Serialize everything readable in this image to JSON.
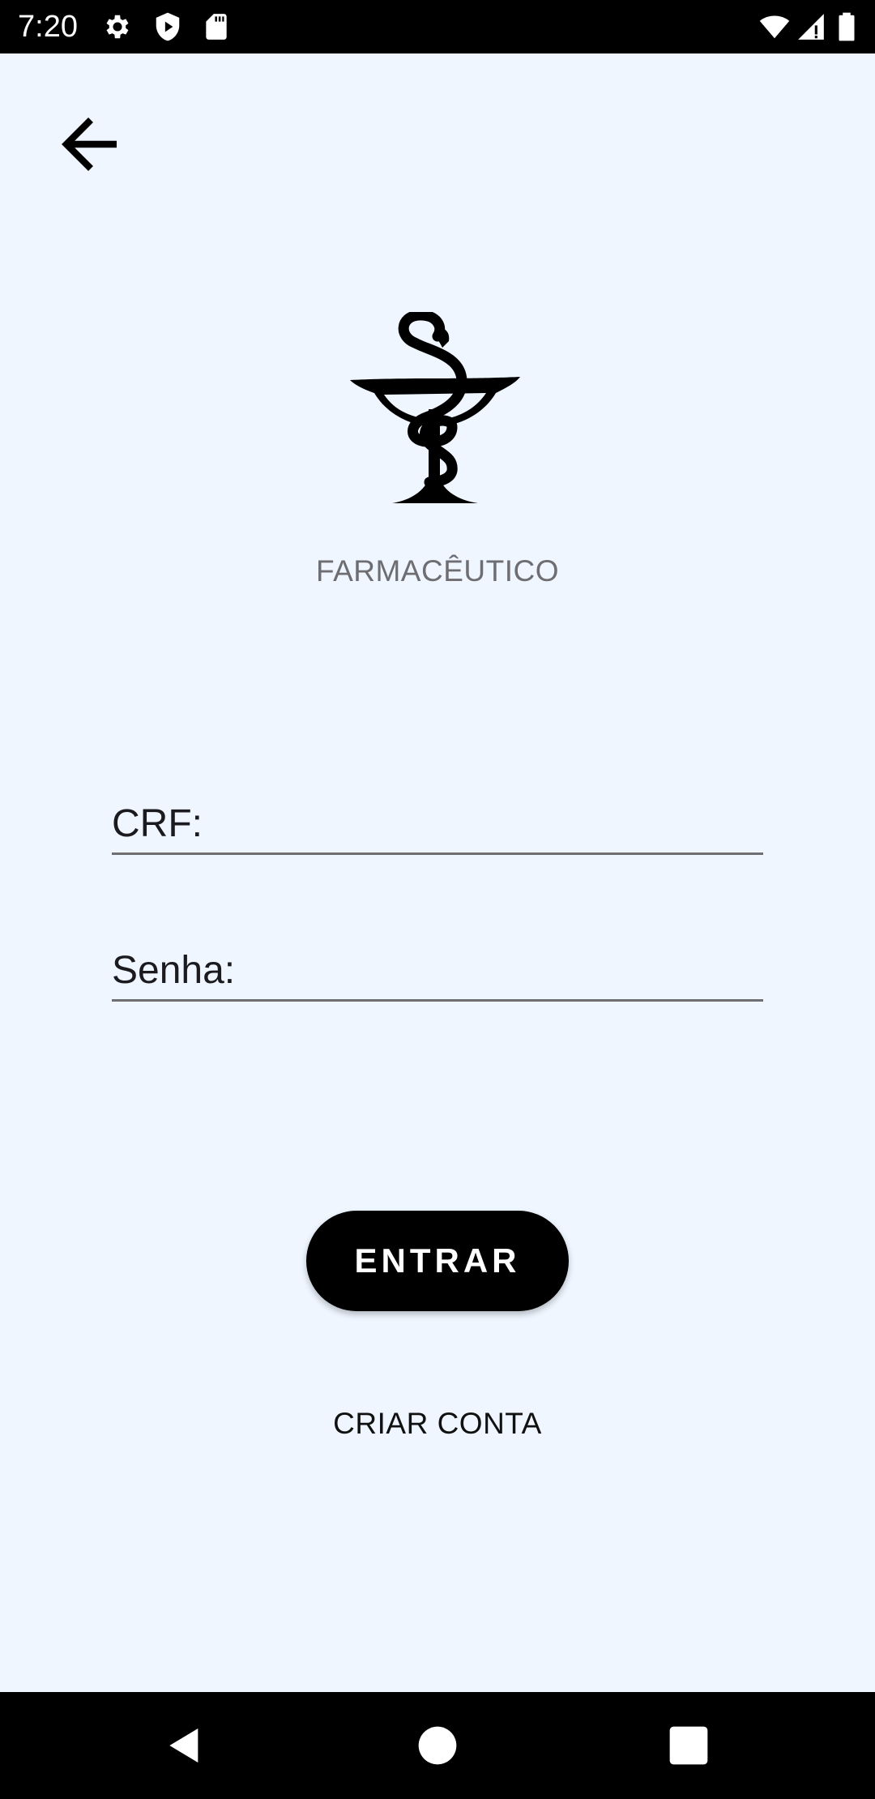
{
  "status_bar": {
    "time": "7:20",
    "left_icons": [
      "gear-icon",
      "shield-play-icon",
      "sd-card-icon"
    ],
    "right_icons": [
      "wifi-icon",
      "signal-icon",
      "battery-icon"
    ]
  },
  "header": {
    "back_icon": "arrow-left-icon"
  },
  "logo": {
    "icon": "bowl-of-hygieia-icon"
  },
  "role_label": "FARMACÊUTICO",
  "form": {
    "crf_label": "CRF:",
    "crf_value": "",
    "senha_label": "Senha:",
    "senha_value": ""
  },
  "actions": {
    "enter_label": "ENTRAR",
    "create_account_label": "CRIAR CONTA"
  },
  "nav_bar": {
    "icons": [
      "back-triangle-icon",
      "home-circle-icon",
      "recents-square-icon"
    ]
  },
  "colors": {
    "background": "#eff6ff",
    "primary": "#000000",
    "label_gray": "#6d6d72",
    "underline": "#6f6f73"
  }
}
